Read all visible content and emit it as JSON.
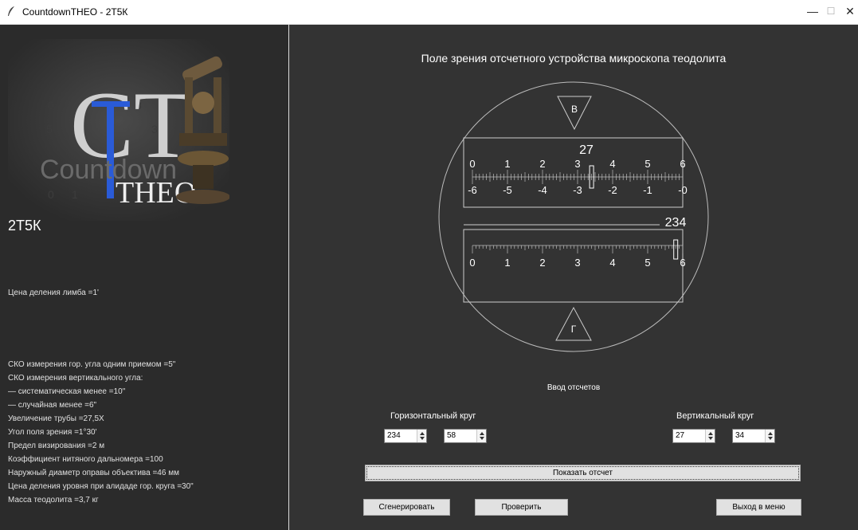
{
  "window": {
    "title": "CountdownTHEO - 2Т5К",
    "minimize_glyph": "—",
    "maximize_glyph": "☐",
    "close_glyph": "✕"
  },
  "logo": {
    "letters": "CT",
    "word1": "Countdown",
    "word2": "THEO",
    "image": "theodolite-photo"
  },
  "left": {
    "model": "2Т5К",
    "limb_price": "Цена деления лимба =1'",
    "specs": [
      "СКО измерения гор. угла одним приемом =5\"",
      "СКО измерения вертикального угла:",
      "— систематическая менее =10\"",
      "— случайная менее =6\"",
      "Увеличение трубы =27,5X",
      "Угол поля зрения =1°30'",
      "Предел визирования =2 м",
      "Коэффициент нитяного дальномера =100",
      "Наружный диаметр оправы объектива =46 мм",
      "Цена деления уровня при алидаде гор. круга =30\"",
      "Масса теодолита =3,7 кг"
    ]
  },
  "view": {
    "title": "Поле зрения отсчетного устройства микроскопа теодолита",
    "v_label": "В",
    "h_label": "Г",
    "v_degree": "27",
    "h_degree": "234",
    "v_top_numbers": [
      "0",
      "1",
      "2",
      "3",
      "4",
      "5",
      "6"
    ],
    "v_bottom_numbers": [
      "-6",
      "-5",
      "-4",
      "-3",
      "-2",
      "-1",
      "-0"
    ],
    "h_numbers": [
      "0",
      "1",
      "2",
      "3",
      "4",
      "5",
      "6"
    ],
    "v_index_value": 3.4,
    "h_index_value": 5.8
  },
  "input": {
    "section_title": "Ввод отсчетов",
    "horizontal_label": "Горизонтальный круг",
    "vertical_label": "Вертикальный круг",
    "h_degrees": "234",
    "h_minutes": "58",
    "v_degrees": "27",
    "v_minutes": "34"
  },
  "buttons": {
    "show": "Показать отсчет",
    "generate": "Сгенерировать",
    "check": "Проверить",
    "exit": "Выход в меню"
  }
}
